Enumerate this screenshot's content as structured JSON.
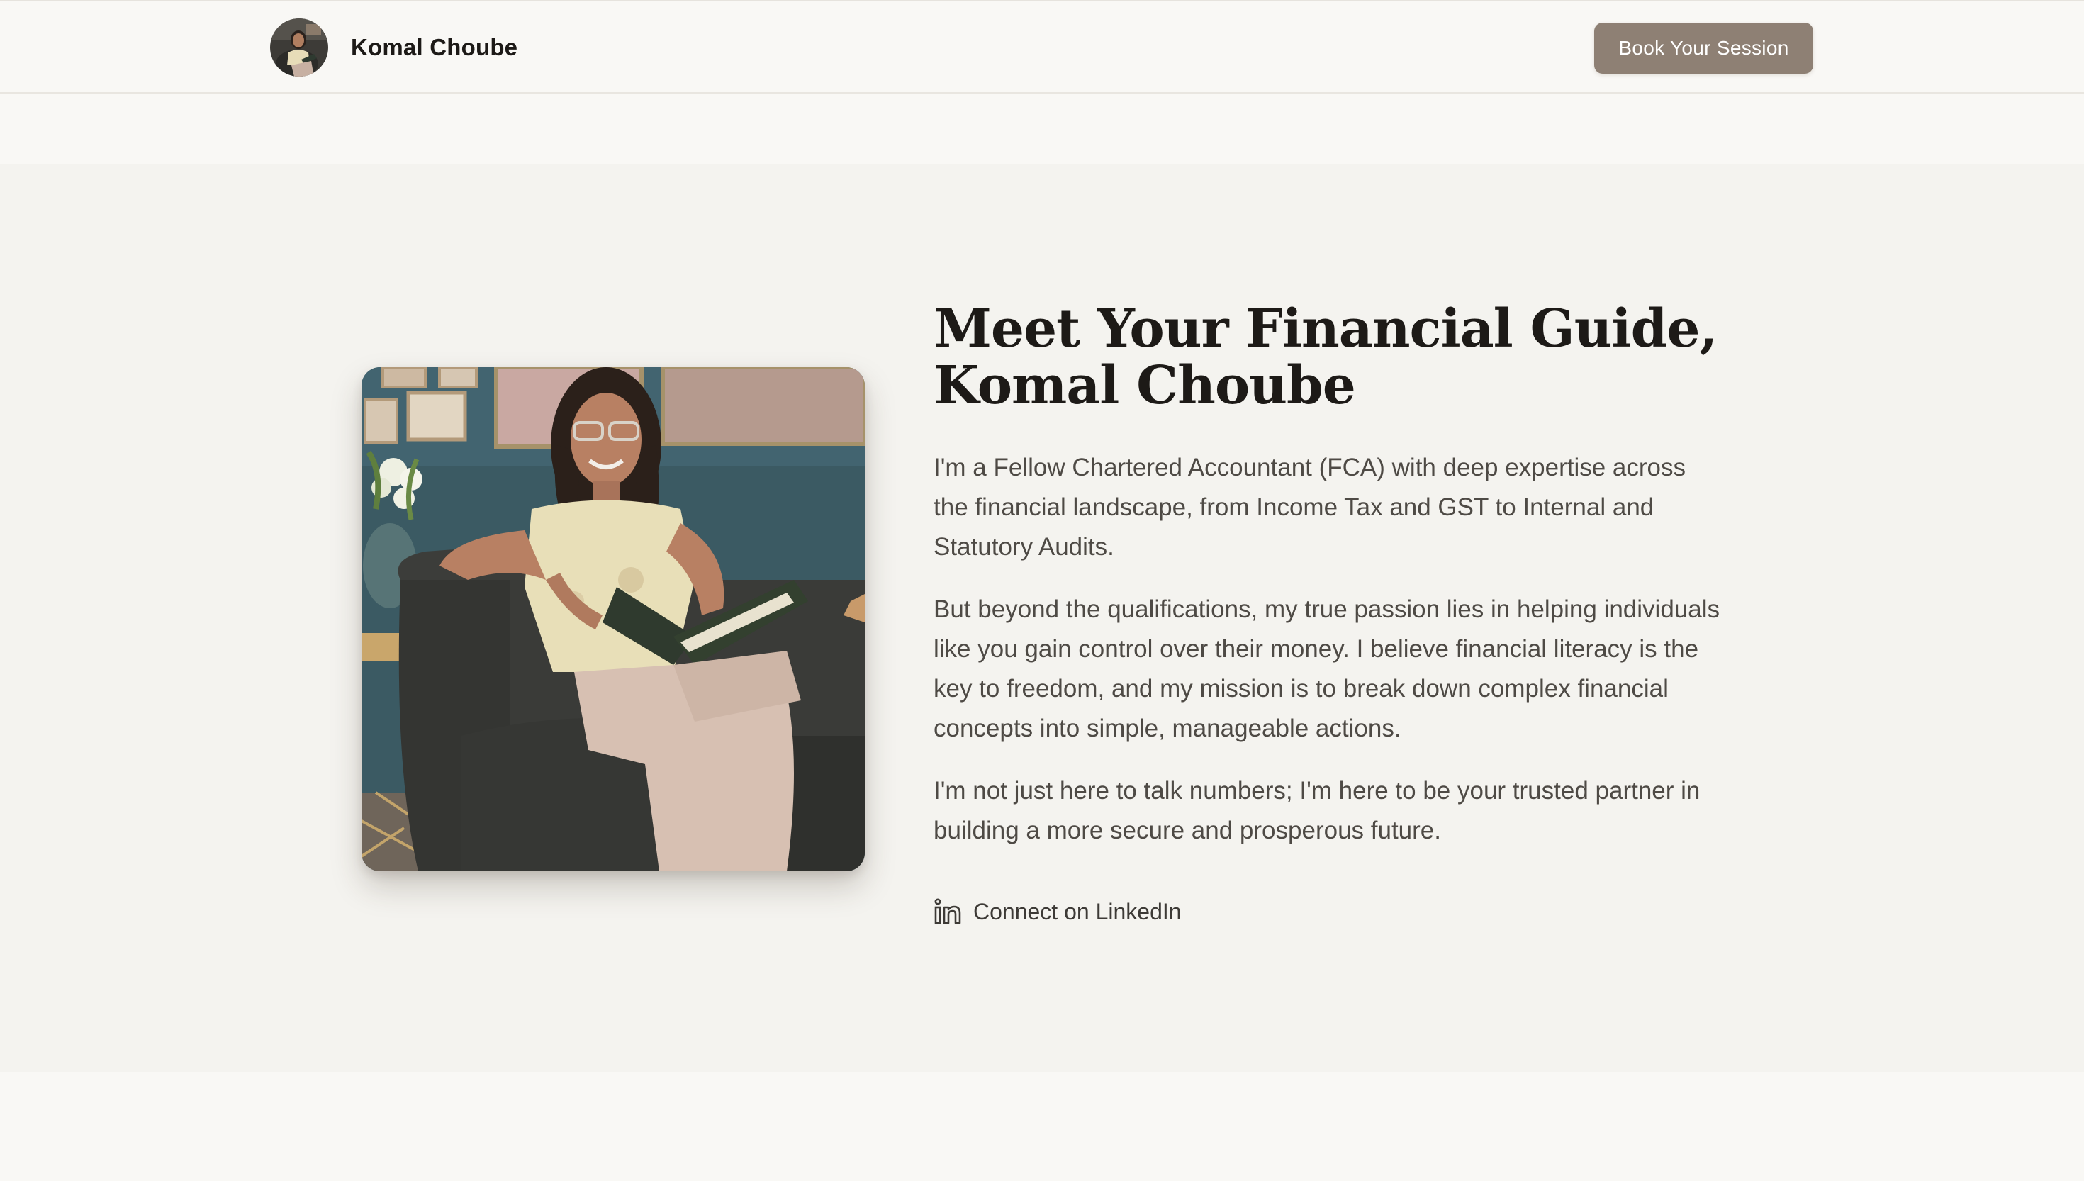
{
  "header": {
    "brand_name": "Komal Choube",
    "avatar_icon": "avatar-photo",
    "cta_label": "Book Your Session"
  },
  "about": {
    "headline_line1": "Meet Your Financial Guide,",
    "headline_line2": "Komal Choube",
    "paragraphs": [
      "I'm a Fellow Chartered Accountant (FCA) with deep expertise across the financial landscape, from Income Tax and GST to Internal and Statutory Audits.",
      "But beyond the qualifications, my true passion lies in helping individuals like you gain control over their money. I believe financial literacy is the key to freedom, and my mission is to break down complex financial concepts into simple, manageable actions.",
      "I'm not just here to talk numbers; I'm here to be your trusted partner in building a more secure and prosperous future."
    ],
    "linkedin_label": "Connect on LinkedIn",
    "linkedin_icon": "linkedin-icon"
  },
  "colors": {
    "page_bg": "#f9f8f5",
    "section_bg": "#f4f3ef",
    "button_bg": "#8e8074",
    "heading": "#1d1a17",
    "body_text": "#4e4a45"
  }
}
